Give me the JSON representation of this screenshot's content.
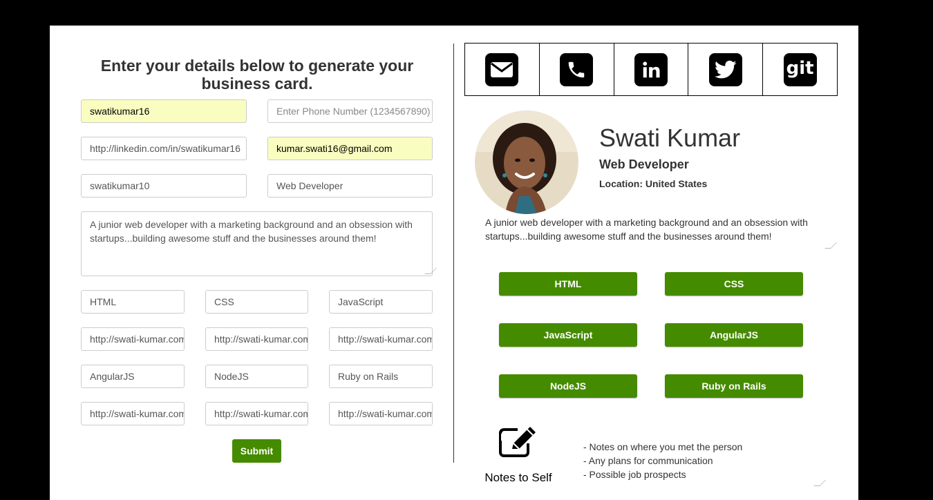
{
  "form": {
    "title": "Enter your details below to generate your business card.",
    "username": "swatikumar16",
    "phone_placeholder": "Enter Phone Number (1234567890)",
    "linkedin": "http://linkedin.com/in/swatikumar16",
    "email": "kumar.swati16@gmail.com",
    "twitter": "swatikumar10",
    "job_title": "Web Developer",
    "bio": "A junior web developer with a marketing background and an obsession with startups...building awesome stuff and the businesses around them!",
    "skills": [
      {
        "name": "HTML",
        "link": "http://swati-kumar.com"
      },
      {
        "name": "CSS",
        "link": "http://swati-kumar.com"
      },
      {
        "name": "JavaScript",
        "link": "http://swati-kumar.com"
      },
      {
        "name": "AngularJS",
        "link": "http://swati-kumar.com"
      },
      {
        "name": "NodeJS",
        "link": "http://swati-kumar.com"
      },
      {
        "name": "Ruby on Rails",
        "link": "http://swati-kumar.com"
      }
    ],
    "submit_label": "Submit"
  },
  "card": {
    "social_icons": [
      "email-icon",
      "phone-icon",
      "linkedin-icon",
      "twitter-icon",
      "git-icon"
    ],
    "git_label": "git",
    "name": "Swati Kumar",
    "title": "Web Developer",
    "location": "Location: United States",
    "bio": "A junior web developer with a marketing background and an obsession with startups...building awesome stuff and the businesses around them!",
    "skills": [
      "HTML",
      "CSS",
      "JavaScript",
      "AngularJS",
      "NodeJS",
      "Ruby on Rails"
    ],
    "notes_label": "Notes to Self",
    "notes": "- Notes on where you met the person\n- Any plans for communication\n- Possible job prospects"
  },
  "colors": {
    "accent_green": "#458b00",
    "autofill_yellow": "#fafdc0",
    "background": "#000000"
  }
}
